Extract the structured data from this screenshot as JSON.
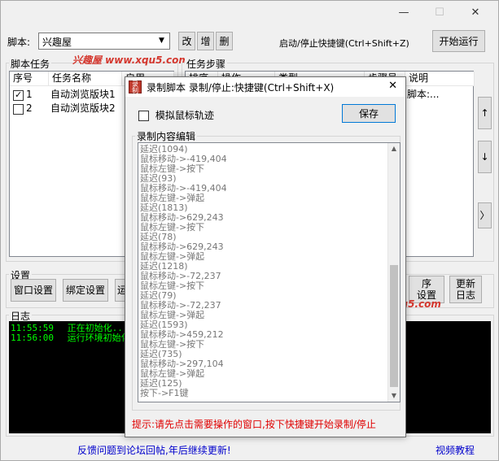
{
  "window": {
    "minimize": "—",
    "maximize": "☐",
    "close": "✕"
  },
  "top": {
    "script_label": "脚本:",
    "script_value": "兴趣屋",
    "btn_edit": "改",
    "btn_add": "增",
    "btn_delete": "删",
    "hotkey_text": "启动/停止快捷键(Ctrl+Shift+Z)",
    "btn_start": "开始运行"
  },
  "tasks": {
    "label": "脚本任务",
    "headers": [
      "序号",
      "任务名称",
      "启用"
    ],
    "rows": [
      {
        "index": "1",
        "name": "自动浏览版块1",
        "checked": true
      },
      {
        "index": "2",
        "name": "自动浏览版块2",
        "checked": false
      }
    ]
  },
  "steps": {
    "label": "任务步骤",
    "headers": [
      "排序",
      "操作",
      "类型",
      "步骤号",
      "说明"
    ],
    "row1_text": "脚本:...",
    "btn_up": "↑",
    "btn_down": "↓",
    "btn_more": "〉"
  },
  "settings": {
    "label": "设置",
    "btn_window": "窗口设置",
    "btn_bind": "绑定设置",
    "btn_run": "运",
    "btn_order_line1": "序",
    "btn_order_line2": "设置",
    "btn_update_line1": "更新",
    "btn_update_line2": "日志"
  },
  "log": {
    "label": "日志",
    "lines": [
      {
        "time": "11:55:59",
        "text": "正在初始化..."
      },
      {
        "time": "11:56:00",
        "text": "运行环境初始化"
      }
    ]
  },
  "footer": {
    "feedback": "反馈问题到论坛回帖,年后继续更新!",
    "tutorial": "视频教程"
  },
  "watermarks": {
    "top": "兴趣屋 www.xqu5.com",
    "bottom": "兴趣屋 www.xqu5.com"
  },
  "dialog": {
    "icon_text": "录制",
    "title": "录制脚本 录制/停止:快捷键(Ctrl+Shift+X)",
    "close": "✕",
    "simulate_label": "模拟鼠标轨迹",
    "simulate_checked": false,
    "btn_save": "保存",
    "editor_label": "录制内容编辑",
    "editor_text": "延迟(1094)\n鼠标移动->-419,404\n鼠标左键->按下\n延迟(93)\n鼠标移动->-419,404\n鼠标左键->弹起\n延迟(1813)\n鼠标移动->629,243\n鼠标左键->按下\n延迟(78)\n鼠标移动->629,243\n鼠标左键->弹起\n延迟(1218)\n鼠标移动->-72,237\n鼠标左键->按下\n延迟(79)\n鼠标移动->-72,237\n鼠标左键->弹起\n延迟(1593)\n鼠标移动->459,212\n鼠标左键->按下\n延迟(735)\n鼠标移动->297,104\n鼠标左键->弹起\n延迟(125)\n按下->F1键",
    "hint": "提示:请先点击需要操作的窗口,按下快捷键开始录制/停止",
    "hint_color": "#e00000"
  }
}
